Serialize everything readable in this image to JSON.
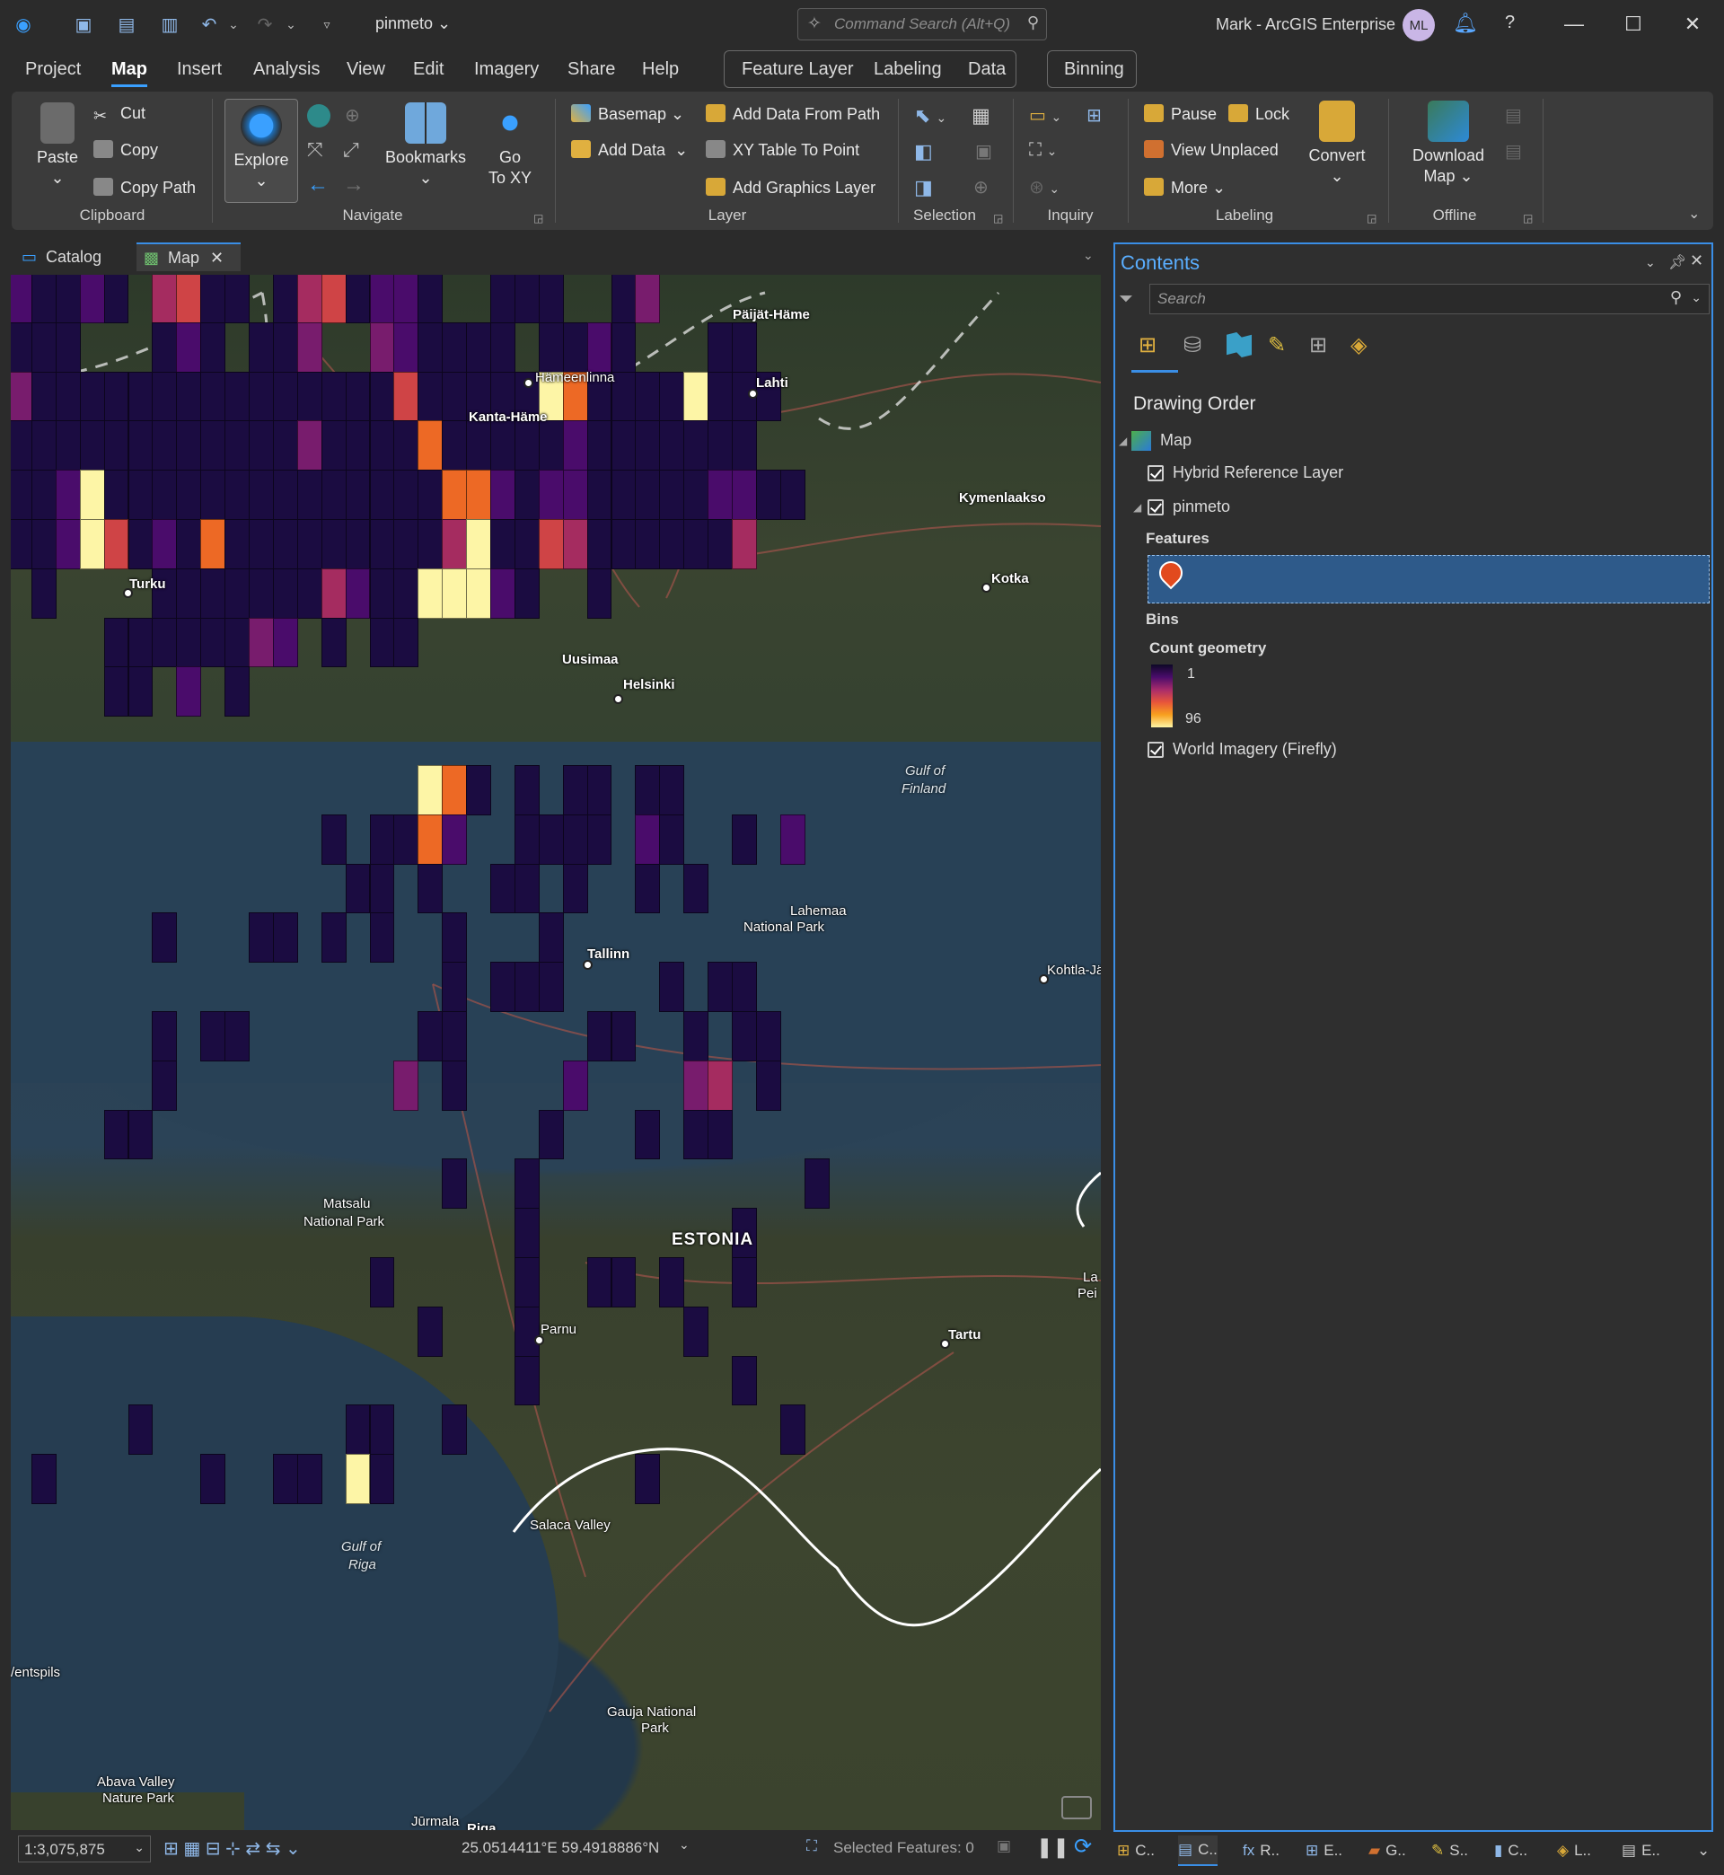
{
  "app": {
    "project_name": "pinmeto",
    "command_search_placeholder": "Command Search (Alt+Q)",
    "user_label": "Mark - ArcGIS Enterprise",
    "avatar_initials": "ML"
  },
  "ribbon_tabs": [
    "Project",
    "Map",
    "Insert",
    "Analysis",
    "View",
    "Edit",
    "Imagery",
    "Share",
    "Help"
  ],
  "active_tab": "Map",
  "context_tabs": [
    "Feature Layer",
    "Labeling",
    "Data"
  ],
  "extra_tab": "Binning",
  "clipboard": {
    "paste": "Paste",
    "cut": "Cut",
    "copy": "Copy",
    "copy_path": "Copy Path",
    "group": "Clipboard"
  },
  "navigate": {
    "explore": "Explore",
    "bookmarks": "Bookmarks",
    "go_to_xy": "Go\nTo XY",
    "go": "Go",
    "to_xy": "To XY",
    "group": "Navigate"
  },
  "layer": {
    "basemap": "Basemap",
    "add_data": "Add Data",
    "add_data_from_path": "Add Data From Path",
    "xy_table_to_point": "XY Table To Point",
    "add_graphics_layer": "Add Graphics Layer",
    "group": "Layer"
  },
  "selection": {
    "group": "Selection"
  },
  "inquiry": {
    "group": "Inquiry"
  },
  "labeling": {
    "pause": "Pause",
    "lock": "Lock",
    "view_unplaced": "View Unplaced",
    "more": "More",
    "convert": "Convert",
    "group": "Labeling"
  },
  "offline": {
    "download": "Download",
    "map": "Map",
    "group": "Offline"
  },
  "doc_tabs": [
    "Catalog",
    "Map"
  ],
  "map_labels": {
    "paijat_hame": "Päijät-Häme",
    "hameenlinna": "Hämeenlinna",
    "lahti": "Lahti",
    "kanta_hame": "Kanta-Häme",
    "kymenlaakso": "Kymenlaakso",
    "turku": "Turku",
    "kotka": "Kotka",
    "uusimaa": "Uusimaa",
    "helsinki": "Helsinki",
    "gulf_finland_1": "Gulf of",
    "gulf_finland_2": "Finland",
    "lahemaa_1": "Lahemaa",
    "lahemaa_2": "National Park",
    "tallinn": "Tallinn",
    "kohtla": "Kohtla-Jä",
    "matsalu_1": "Matsalu",
    "matsalu_2": "National Park",
    "estonia": "ESTONIA",
    "parnu": "Parnu",
    "tartu": "Tartu",
    "lake_1": "La",
    "lake_2": "Pei",
    "salaca": "Salaca Valley",
    "gulf_riga_1": "Gulf of",
    "gulf_riga_2": "Riga",
    "ventspils": "/entspils",
    "gauja_1": "Gauja National",
    "gauja_2": "Park",
    "abava_1": "Abava Valley",
    "abava_2": "Nature Park",
    "jurmala": "Jūrmala",
    "riga": "Riga"
  },
  "contents": {
    "title": "Contents",
    "search_placeholder": "Search",
    "drawing_order": "Drawing Order",
    "map": "Map",
    "hybrid": "Hybrid Reference Layer",
    "pinmeto": "pinmeto",
    "features": "Features",
    "bins": "Bins",
    "count_geometry": "Count geometry",
    "legend_min": "1",
    "legend_max": "96",
    "world_imagery": "World Imagery (Firefly)"
  },
  "status": {
    "scale": "1:3,075,875",
    "coords": "25.0514411°E 59.4918886°N",
    "selected": "Selected Features: 0"
  },
  "bottom_tabs": [
    "C..",
    "C..",
    "R..",
    "E..",
    "G..",
    "S..",
    "C..",
    "L..",
    "E.."
  ],
  "colors": {
    "accent": "#3a8ee6",
    "bin_low": "#0d0826",
    "bin_high": "#fdf5a6"
  }
}
